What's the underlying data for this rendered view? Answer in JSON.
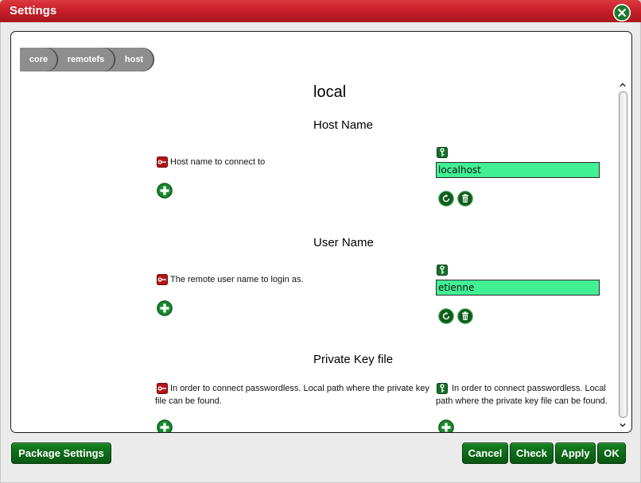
{
  "window": {
    "title": "Settings"
  },
  "breadcrumb": [
    "core",
    "remotefs",
    "host"
  ],
  "section": {
    "title": "local"
  },
  "settings": [
    {
      "name": "Host Name",
      "description": "Host name to connect to",
      "value": "localhost"
    },
    {
      "name": "User Name",
      "description": "The remote user name to login as.",
      "value": "etienne"
    },
    {
      "name": "Private Key file",
      "description": "In order to connect passwordless. Local path where the private key file can be found.",
      "value_hint": "In order to connect passwordless. Local path where the private key file can be found."
    }
  ],
  "footer": {
    "package_settings": "Package Settings",
    "cancel": "Cancel",
    "check": "Check",
    "apply": "Apply",
    "ok": "OK"
  },
  "icons": {
    "close": "close-icon",
    "description_marker": "red-key-icon",
    "value_marker": "green-key-icon",
    "add": "plus-icon",
    "reset": "refresh-icon",
    "delete": "trash-icon",
    "scroll_up": "chevron-up-icon",
    "scroll_down": "chevron-down-icon"
  },
  "colors": {
    "title_bar": "#c81f28",
    "button": "#0d6b18",
    "input_background": "#42f094",
    "breadcrumb": "#8e8e8e",
    "description_marker": "#b31616",
    "icon_green": "#178a2b"
  }
}
